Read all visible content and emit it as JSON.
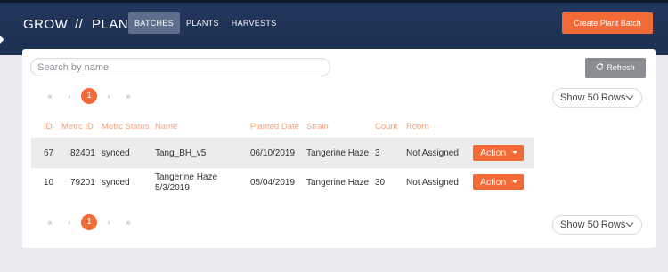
{
  "header": {
    "brand_left": "GROW",
    "brand_sep": "//",
    "brand_right": "PLANTS",
    "nav": [
      {
        "label": "BATCHES",
        "active": true
      },
      {
        "label": "PLANTS",
        "active": false
      },
      {
        "label": "HARVESTS",
        "active": false
      }
    ],
    "create_button": "Create Plant Batch",
    "accent_color": "#f26a35",
    "bg_color": "#1f3456"
  },
  "toolbar": {
    "search_placeholder": "Search by name",
    "refresh_label": "Refresh",
    "refresh_icon": "refresh-icon"
  },
  "pagination": {
    "first": "«",
    "prev": "‹",
    "current": "1",
    "next": "›",
    "last": "»",
    "rows_select": "Show 50 Rows"
  },
  "table": {
    "columns": [
      "ID",
      "Metrc ID",
      "Metrc Status",
      "Name",
      "Planted Date",
      "Strain",
      "Count",
      "Room"
    ],
    "rows": [
      {
        "id": "67",
        "metrc_id": "82401",
        "status": "synced",
        "name": "Tang_BH_v5",
        "planted": "06/10/2019",
        "strain": "Tangerine Haze",
        "count": "3",
        "room": "Not Assigned",
        "action": "Action"
      },
      {
        "id": "10",
        "metrc_id": "79201",
        "status": "synced",
        "name": "Tangerine Haze 5/3/2019",
        "planted": "05/04/2019",
        "strain": "Tangerine Haze",
        "count": "30",
        "room": "Not Assigned",
        "action": "Action"
      }
    ]
  }
}
